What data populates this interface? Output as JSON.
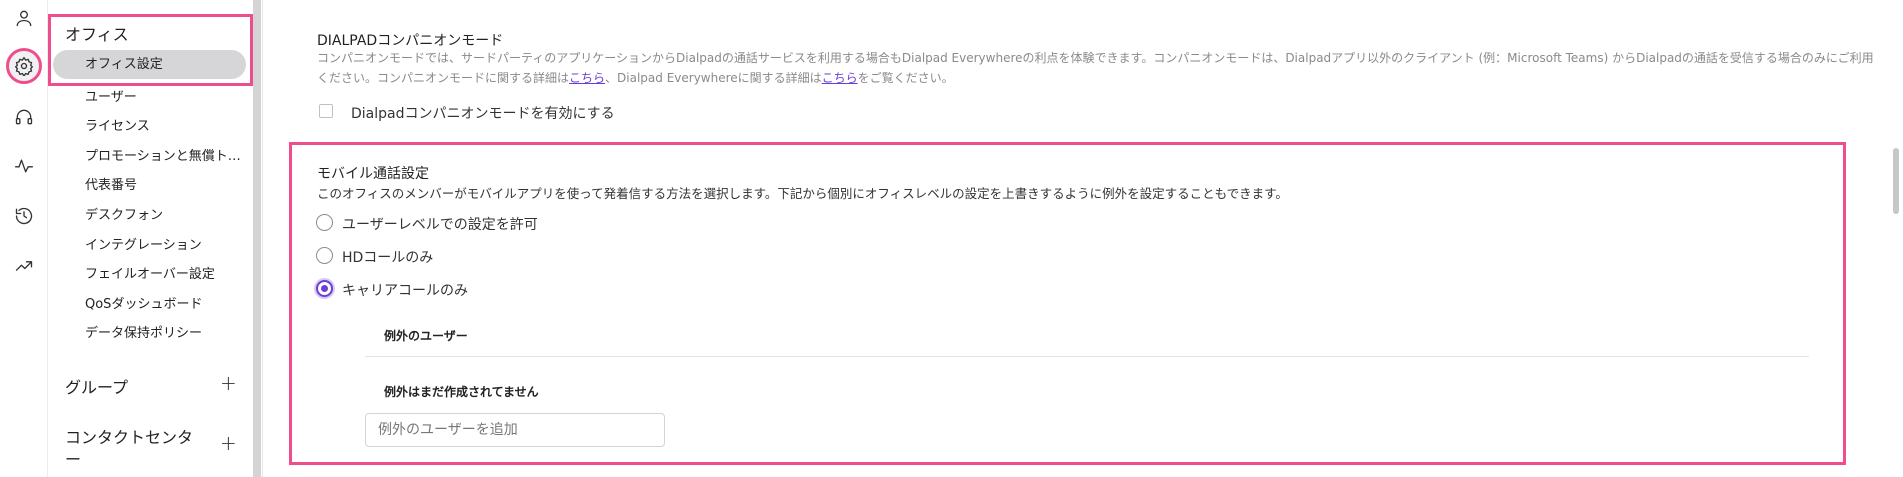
{
  "rail": {
    "icons": [
      "user-icon",
      "gear-icon",
      "headset-icon",
      "activity-icon",
      "history-icon",
      "trending-icon"
    ]
  },
  "sidebar": {
    "office_title": "オフィス",
    "items": [
      {
        "label": "オフィス設定",
        "selected": true
      },
      {
        "label": "ユーザー"
      },
      {
        "label": "ライセンス"
      },
      {
        "label": "プロモーションと無償トラ..."
      },
      {
        "label": "代表番号"
      },
      {
        "label": "デスクフォン"
      },
      {
        "label": "インテグレーション"
      },
      {
        "label": "フェイルオーバー設定"
      },
      {
        "label": "QoSダッシュボード"
      },
      {
        "label": "データ保持ポリシー"
      }
    ],
    "groups_title": "グループ",
    "contact_center_title_line1": "コンタクトセンタ",
    "contact_center_title_line2": "ー",
    "plus_symbol": "+"
  },
  "companion": {
    "title": "DIALPADコンパニオンモード",
    "desc_line1": "コンパニオンモードでは、サードパーティのアプリケーションからDialpadの通話サービスを利用する場合もDialpad Everywhereの利点を体験できます。コンパニオンモードは、Dialpadアプリ以外のクライアント (例：Microsoft Teams) からDialpadの通話を受信する場合のみにご利用",
    "desc_line2_a": "ください。コンパニオンモードに関する詳細は",
    "link1": "こちら",
    "desc_line2_b": "、Dialpad Everywhereに関する詳細は",
    "link2": "こちら",
    "desc_line2_c": "をご覧ください。",
    "checkbox_label": "Dialpadコンパニオンモードを有効にする"
  },
  "mobile": {
    "title": "モバイル通話設定",
    "desc": "このオフィスのメンバーがモバイルアプリを使って発着信する方法を選択します。下記から個別にオフィスレベルの設定を上書きするように例外を設定することもできます。",
    "options": [
      {
        "label": "ユーザーレベルでの設定を許可",
        "checked": false
      },
      {
        "label": "HDコールのみ",
        "checked": false
      },
      {
        "label": "キャリアコールのみ",
        "checked": true
      }
    ],
    "exceptions_header": "例外のユーザー",
    "no_exceptions": "例外はまだ作成されてません",
    "add_placeholder": "例外のユーザーを追加"
  },
  "colors": {
    "highlight": "#ee4f8c",
    "accent": "#6a3fd6"
  }
}
